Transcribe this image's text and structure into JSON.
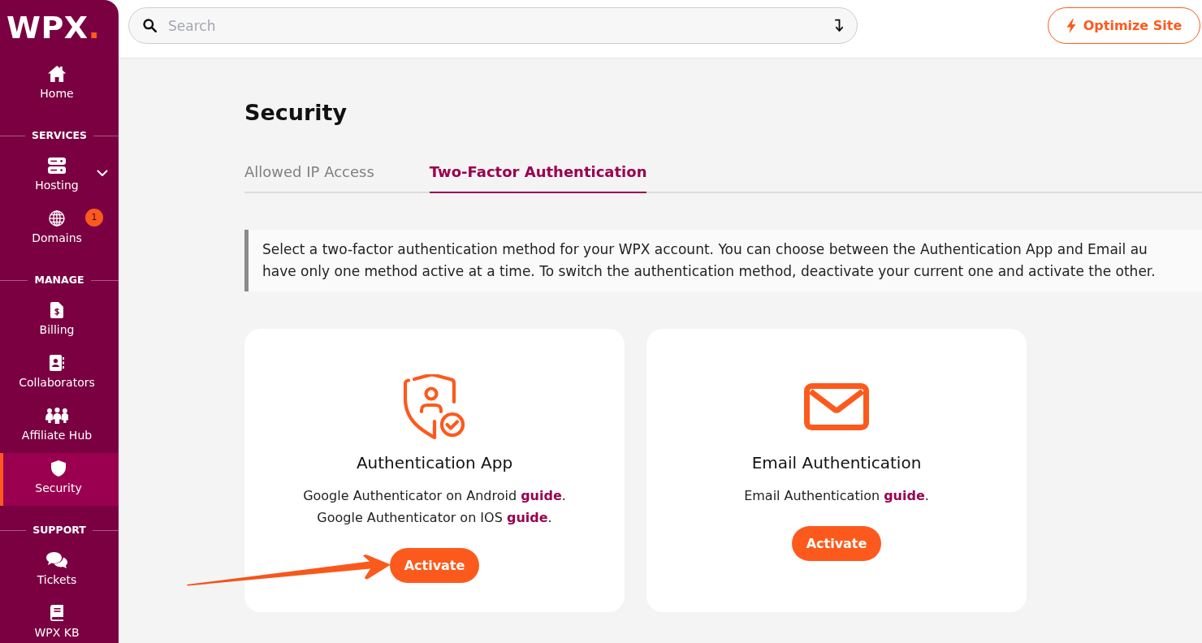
{
  "logo": {
    "text": "WPX",
    "dot": "."
  },
  "sidebar": {
    "groups": [
      {
        "items": [
          {
            "label": "Home",
            "selected": false
          }
        ]
      },
      {
        "heading": "SERVICES",
        "items": [
          {
            "label": "Hosting",
            "selected": false,
            "expanded": false
          },
          {
            "label": "Domains",
            "selected": false,
            "badge": "1"
          }
        ]
      },
      {
        "heading": "MANAGE",
        "items": [
          {
            "label": "Billing",
            "selected": false
          },
          {
            "label": "Collaborators",
            "selected": false
          },
          {
            "label": "Affiliate Hub",
            "selected": false
          },
          {
            "label": "Security",
            "selected": true
          }
        ]
      },
      {
        "heading": "SUPPORT",
        "items": [
          {
            "label": "Tickets",
            "selected": false
          },
          {
            "label": "WPX KB",
            "selected": false
          }
        ]
      }
    ]
  },
  "search": {
    "placeholder": "Search"
  },
  "optimize_button": {
    "label": "Optimize Site"
  },
  "page": {
    "title": "Security",
    "tabs": [
      {
        "label": "Allowed IP Access",
        "selected": false
      },
      {
        "label": "Two-Factor Authentication",
        "selected": true
      }
    ],
    "notice": {
      "lines": [
        "Select a two-factor authentication method for your WPX account. You can choose between the Authentication App and Email au",
        "have only one method active at a time. To switch the authentication method, deactivate your current one and activate the other."
      ]
    },
    "methods": [
      {
        "title": "Authentication App",
        "guides": [
          {
            "text": "Google Authenticator on Android",
            "link": "guide",
            "end": "."
          },
          {
            "text": "Google Authenticator on IOS",
            "link": "guide",
            "end": "."
          }
        ],
        "button": "Activate"
      },
      {
        "title": "Email Authentication",
        "guides": [
          {
            "text": "Email Authentication",
            "link": "guide",
            "end": "."
          }
        ],
        "button": "Activate"
      }
    ]
  }
}
